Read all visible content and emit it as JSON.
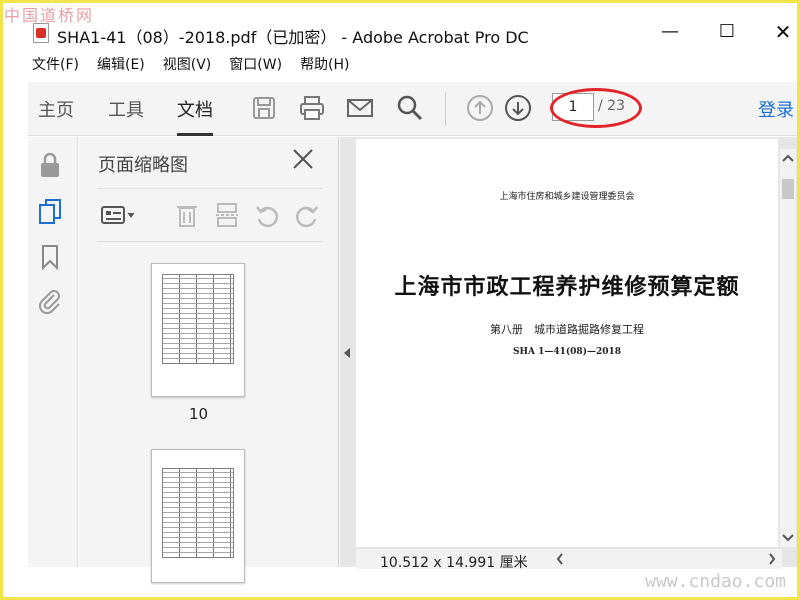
{
  "watermark_top": "中国道桥网",
  "watermark_bottom": "www.cndao.com",
  "window": {
    "title": "SHA1-41（08）-2018.pdf（已加密） - Adobe Acrobat Pro DC"
  },
  "menu": [
    "文件(F)",
    "编辑(E)",
    "视图(V)",
    "窗口(W)",
    "帮助(H)"
  ],
  "toolbar": {
    "tabs": [
      "主页",
      "工具",
      "文档"
    ],
    "active_tab": "文档",
    "page_current": "1",
    "page_total": "/ 23",
    "login": "登录"
  },
  "thumbnails": {
    "title": "页面缩略图",
    "items": [
      {
        "label": "10"
      },
      {
        "label": ""
      }
    ]
  },
  "document": {
    "org": "上海市住房和城乡建设管理委员会",
    "title": "上海市市政工程养护维修预算定额",
    "subtitle": "第八册　城市道路掘路修复工程",
    "code": "SHA 1—41(08)—2018",
    "status": "10.512 x 14.991 厘米"
  },
  "colors": {
    "accent": "#1a6fd0",
    "highlight": "#e0242a",
    "border_frame": "#f1e34a"
  }
}
